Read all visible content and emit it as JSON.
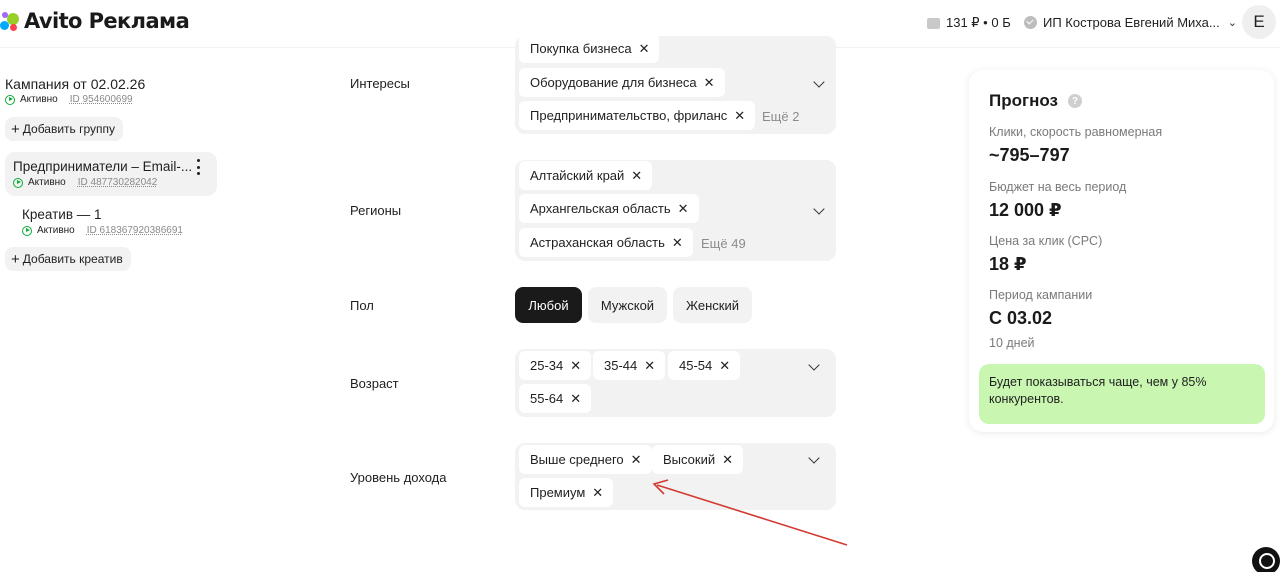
{
  "header": {
    "brand_avito": "Avito",
    "brand_reklama": "Реклама",
    "balance": "131 ₽ • 0 Б",
    "account_name": "ИП Кострова Евгений Миха...",
    "avatar_letter": "E"
  },
  "sidebar": {
    "campaign": {
      "title": "Кампания от 02.02.26",
      "status": "Активно",
      "id": "ID 954600699"
    },
    "add_group_label": "Добавить группу",
    "group": {
      "name": "Предприниматели – Email-...",
      "status": "Активно",
      "id": "ID 487730282042"
    },
    "creative": {
      "name": "Креатив — 1",
      "status": "Активно",
      "id": "ID 618367920386691"
    },
    "add_creative_label": "Добавить креатив"
  },
  "form": {
    "interests": {
      "label": "Интересы",
      "chips": [
        "Покупка бизнеса",
        "Оборудование для бизнеса",
        "Предпринимательство, фриланс"
      ],
      "more": "Ещё 2"
    },
    "regions": {
      "label": "Регионы",
      "chips": [
        "Алтайский край",
        "Архангельская область",
        "Астраханская область"
      ],
      "more": "Ещё 49"
    },
    "gender": {
      "label": "Пол",
      "options": [
        "Любой",
        "Мужской",
        "Женский"
      ],
      "selected": "Любой"
    },
    "age": {
      "label": "Возраст",
      "chips": [
        "25-34",
        "35-44",
        "45-54",
        "55-64"
      ]
    },
    "income": {
      "label": "Уровень дохода",
      "chips": [
        "Выше среднего",
        "Высокий",
        "Премиум"
      ]
    }
  },
  "forecast": {
    "title": "Прогноз",
    "clicks_label": "Клики, скорость равномерная",
    "clicks_value": "~795–797",
    "budget_label": "Бюджет на весь период",
    "budget_value": "12 000 ₽",
    "cpc_label": "Цена за клик (CPC)",
    "cpc_value": "18 ₽",
    "period_label": "Период кампании",
    "period_value": "С 03.02",
    "period_days": "10 дней",
    "note": "Будет показываться чаще, чем у 85% конкурентов."
  },
  "colors": {
    "accent_selected": "#1a1a1a",
    "status_green": "#0cab3a",
    "note_bg": "#c9f7b2",
    "annotation_arrow": "#d23b32"
  },
  "icons": [
    "avito-logo-icon",
    "wallet-icon",
    "verified-icon",
    "chevron-down-icon",
    "plus-icon",
    "more-vertical-icon",
    "close-icon",
    "help-icon",
    "support-icon"
  ]
}
